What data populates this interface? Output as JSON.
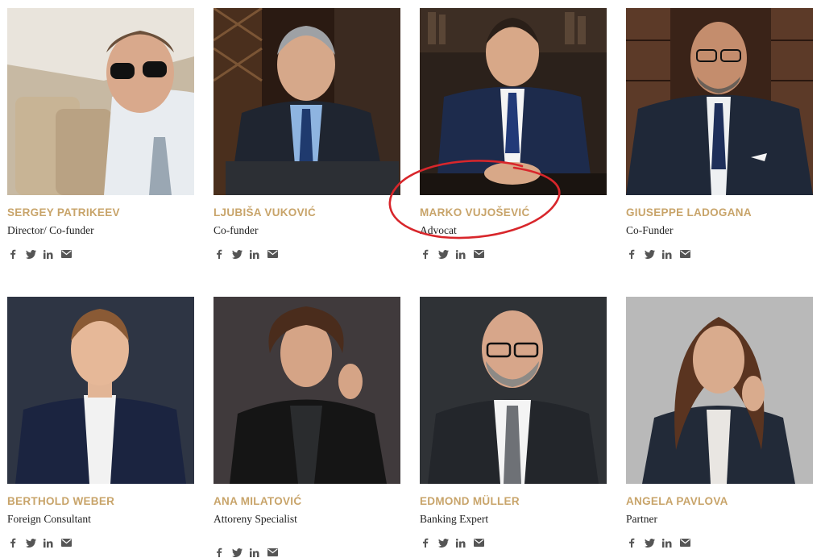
{
  "colors": {
    "name": "#c8a46a",
    "role": "#222222",
    "icon": "#555555",
    "annotation": "#d8262b"
  },
  "social_icons": [
    "facebook-icon",
    "twitter-icon",
    "linkedin-icon",
    "email-icon"
  ],
  "team": [
    {
      "name": "SERGEY PATRIKEEV",
      "role": "Director/ Co-funder"
    },
    {
      "name": "LJUBIŠA VUKOVIĆ",
      "role": "Co-funder"
    },
    {
      "name": "MARKO VUJOŠEVIĆ",
      "role": "Advocat"
    },
    {
      "name": "GIUSEPPE LADOGANA",
      "role": "Co-Funder"
    },
    {
      "name": "BERTHOLD WEBER",
      "role": "Foreign Consultant"
    },
    {
      "name": "ANA MILATOVIĆ",
      "role": "Attoreny Specialist"
    },
    {
      "name": "EDMOND MÜLLER",
      "role": "Banking Expert"
    },
    {
      "name": "ANGELA PAVLOVA",
      "role": "Partner"
    }
  ]
}
